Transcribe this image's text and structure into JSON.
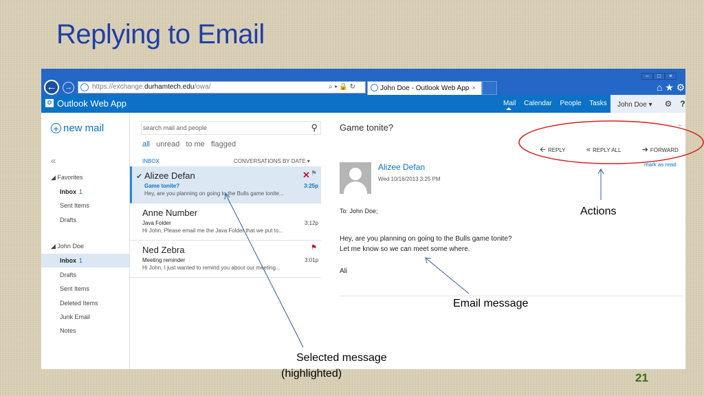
{
  "slide": {
    "title": "Replying to Email",
    "page_number": "21"
  },
  "browser": {
    "url_prefix": "https://exchange.",
    "url_domain": "durhamtech.edu",
    "url_path": "/owa/",
    "address_controls": "⌕ ▾ 🔒 ↻",
    "tab_title": "John Doe - Outlook Web App",
    "tab_close": "×",
    "right_icons": "⌂ ★ ⚙"
  },
  "owa": {
    "app_title": "Outlook Web App",
    "nav": {
      "mail": "Mail",
      "calendar": "Calendar",
      "people": "People",
      "tasks": "Tasks"
    },
    "user_menu": "John Doe ▾"
  },
  "left_pane": {
    "new_mail_label": "new mail",
    "collapse_glyph": "«",
    "favorites_header": "◢ Favorites",
    "favorites": [
      {
        "label": "Inbox",
        "count": "1"
      },
      {
        "label": "Sent Items"
      },
      {
        "label": "Drafts"
      }
    ],
    "account_header": "◢ John Doe",
    "account_folders": [
      {
        "label": "Inbox",
        "count": "1"
      },
      {
        "label": "Drafts"
      },
      {
        "label": "Sent Items"
      },
      {
        "label": "Deleted Items"
      },
      {
        "label": "Junk Email"
      },
      {
        "label": "Notes"
      }
    ]
  },
  "message_list": {
    "search_placeholder": "search mail and people",
    "filters": {
      "all": "all",
      "unread": "unread",
      "to_me": "to me",
      "flagged": "flagged"
    },
    "inbox_label": "INBOX",
    "sort_label": "CONVERSATIONS BY DATE ▾",
    "messages": [
      {
        "sender": "Alizee Defan",
        "subject": "Game tonite?",
        "preview": "Hey, are you planning on going to the Bulls game tonite...",
        "time": "3:25p",
        "selected": true
      },
      {
        "sender": "Anne Number",
        "subject": "Java Folder",
        "preview": "Hi John, Please email me the Java Folder that we put to...",
        "time": "3:12p"
      },
      {
        "sender": "Ned Zebra",
        "subject": "Meeting reminder",
        "preview": "Hi John, I just wanted to remind you about our meeting...",
        "time": "3:01p"
      }
    ]
  },
  "reading_pane": {
    "subject": "Game tonite?",
    "actions": {
      "reply": "REPLY",
      "reply_all": "REPLY ALL",
      "forward": "FORWARD",
      "more": "•••"
    },
    "mark_as_read": "mark as read",
    "from_name": "Alizee Defan",
    "from_date": "Wed 10/16/2013 3:25 PM",
    "to_line": "To:  John Doe;",
    "body": [
      "Hey, are you planning on going to the Bulls game tonite?",
      "Let me know so we can meet some where.",
      "Ali"
    ]
  },
  "annotations": {
    "actions": "Actions",
    "email_message": "Email message",
    "selected_message_l1": "Selected message",
    "selected_message_l2": "(highlighted)"
  },
  "colors": {
    "owa_blue": "#0b72c6",
    "ie_blue": "#2467c6",
    "title_blue": "#1f3fa8",
    "annotation_red": "#d61f1f",
    "selection_bg": "#dbe8f4"
  }
}
